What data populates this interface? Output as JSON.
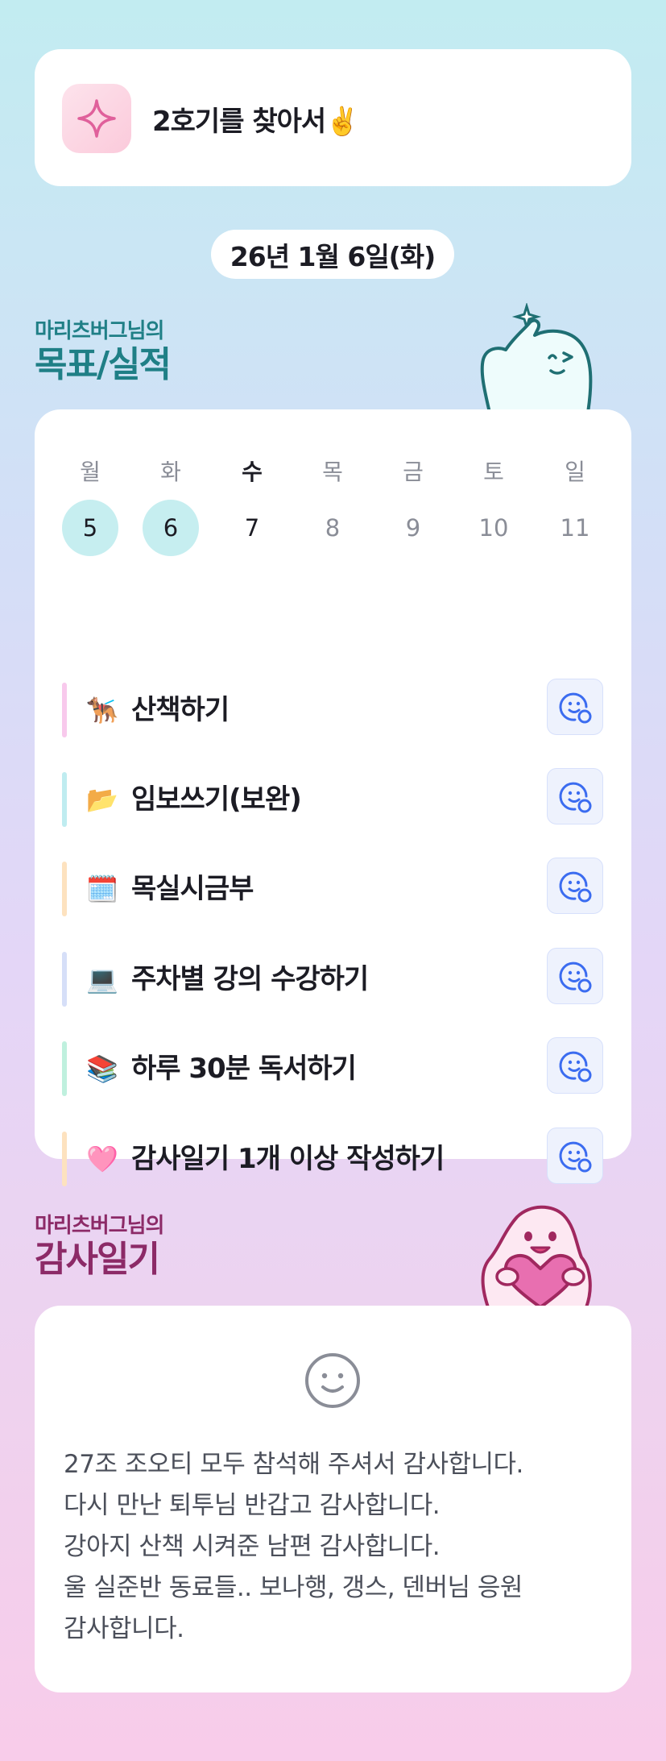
{
  "header": {
    "title": "2호기를 찾아서✌️",
    "icon": "sparkle-icon"
  },
  "date": "26년 1월 6일(화)",
  "goals_section": {
    "subtitle": "마리츠버그님의",
    "title": "목표/실적"
  },
  "week": {
    "days": [
      {
        "name": "월",
        "num": "5",
        "state": "done"
      },
      {
        "name": "화",
        "num": "6",
        "state": "done"
      },
      {
        "name": "수",
        "num": "7",
        "state": "today"
      },
      {
        "name": "목",
        "num": "8",
        "state": "future"
      },
      {
        "name": "금",
        "num": "9",
        "state": "future"
      },
      {
        "name": "토",
        "num": "10",
        "state": "future"
      },
      {
        "name": "일",
        "num": "11",
        "state": "future"
      }
    ]
  },
  "goals": [
    {
      "emoji": "🐕‍🦺",
      "label": "산책하기",
      "color": "#f8c9ec"
    },
    {
      "emoji": "📂",
      "label": "임보쓰기(보완)",
      "color": "#bfecf0"
    },
    {
      "emoji": "🗓️",
      "label": "목실시금부",
      "color": "#fde2bf"
    },
    {
      "emoji": "💻",
      "label": "주차별 강의 수강하기",
      "color": "#d6dff8"
    },
    {
      "emoji": "📚",
      "label": "하루 30분 독서하기",
      "color": "#bff0de"
    },
    {
      "emoji": "🩷",
      "label": "감사일기 1개 이상 작성하기",
      "color": "#fde2bf"
    }
  ],
  "gratitude_section": {
    "subtitle": "마리츠버그님의",
    "title": "감사일기"
  },
  "gratitude": {
    "lines": [
      "27조 조오티 모두 참석해 주셔서 감사합니다.",
      "다시 만난 퇴투님 반갑고 감사합니다.",
      "강아지 산책 시켜준 남편 감사합니다.",
      "울 실준반 동료들.. 보나행, 갱스, 덴버님 응원",
      "감사합니다."
    ]
  },
  "colors": {
    "accent": "#3b6cf0",
    "teal": "#1f7f86",
    "plum": "#8c2a67"
  }
}
